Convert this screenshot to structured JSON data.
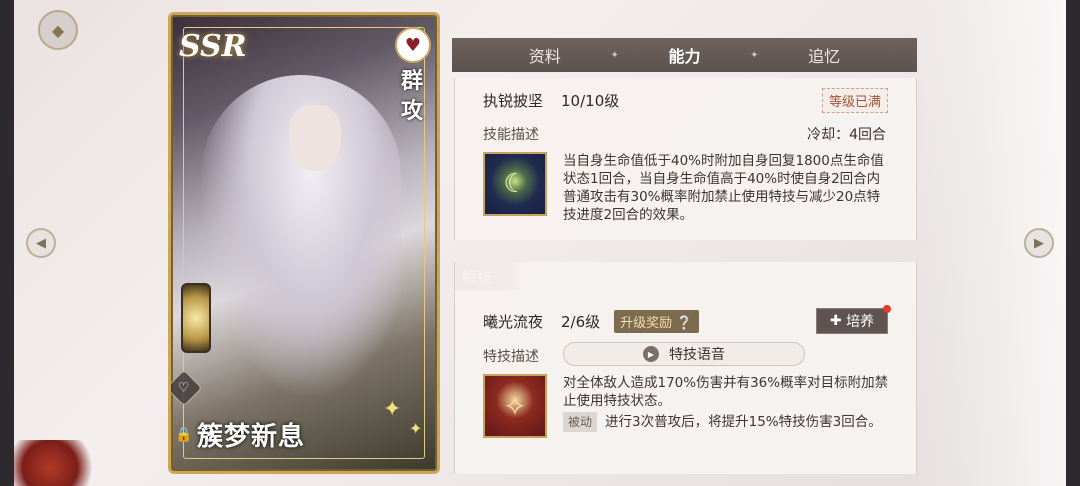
{
  "nav": {
    "home_icon": "compass-icon",
    "left_arrow": "arrow-left-icon",
    "right_arrow": "arrow-right-icon"
  },
  "card": {
    "rarity": "SSR",
    "attack_type": "群攻",
    "name": "簇梦新息"
  },
  "tabs": [
    {
      "label": "资料"
    },
    {
      "label": "能力"
    },
    {
      "label": "追忆"
    }
  ],
  "skill": {
    "name": "执锐披坚",
    "level": "10/10级",
    "max_badge": "等级已满",
    "desc_label": "技能描述",
    "cooldown": "冷却：4回合",
    "description": "当自身生命值低于40%时附加自身回复1800点生命值状态1回合，当自身生命值高于40%时使自身2回合内普通攻击有30%概率附加禁止使用特技与减少20点特技进度2回合的效果。"
  },
  "special": {
    "section_title": "特技",
    "name": "曦光流夜",
    "level": "2/6级",
    "reward_badge": "升级奖励",
    "train_label": "培养",
    "desc_label": "特技描述",
    "voice_label": "特技语音",
    "description": "对全体敌人造成170%伤害并有36%概率对目标附加禁止使用特技状态。",
    "passive_tag": "被动",
    "passive_text": "进行3次普攻后，将提升15%特技伤害3回合。"
  }
}
